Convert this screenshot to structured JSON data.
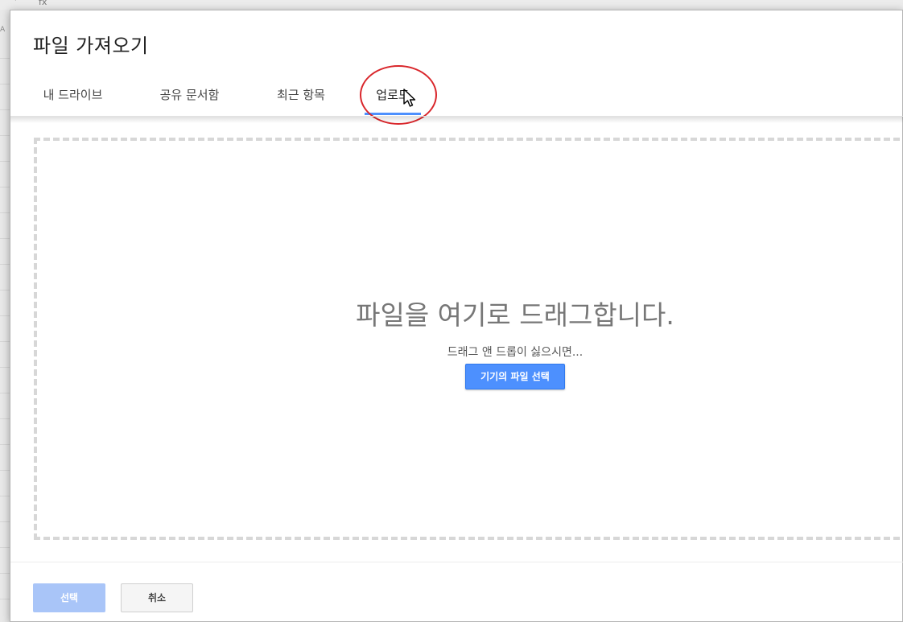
{
  "background": {
    "column_label": "A",
    "formula_icon": "fx",
    "dropdown_icon": "chevron-down-icon"
  },
  "dialog": {
    "title": "파일 가져오기",
    "tabs": [
      {
        "label": "내 드라이브",
        "active": false
      },
      {
        "label": "공유 문서함",
        "active": false
      },
      {
        "label": "최근 항목",
        "active": false
      },
      {
        "label": "업로드",
        "active": true
      }
    ],
    "dropzone": {
      "title": "파일을 여기로 드래그합니다.",
      "subtitle": "드래그 앤 드롭이 싫으시면...",
      "choose_button": "기기의 파일 선택"
    },
    "footer": {
      "select_label": "선택",
      "cancel_label": "취소"
    }
  },
  "colors": {
    "accent": "#4d90fe",
    "annotation_circle": "#d9262b",
    "select_disabled": "#a9c5f8"
  }
}
